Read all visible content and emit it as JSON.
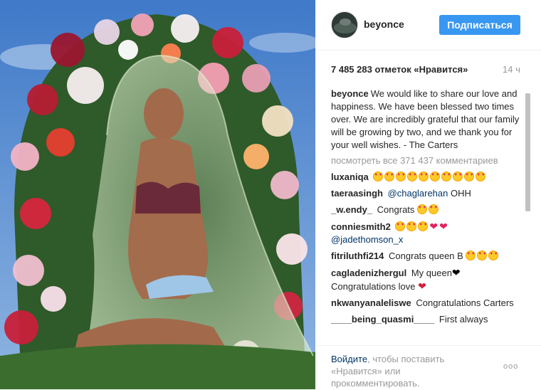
{
  "post": {
    "username": "beyonce",
    "follow_label": "Подписаться",
    "likes_text": "7 485 283 отметок «Нравится»",
    "time_ago": "14 ч",
    "caption_user": "beyonce",
    "caption_text": "We would like to share our love and happiness. We have been blessed two times over. We are incredibly grateful that our family will be growing by two, and we thank you for your well wishes. - The Carters",
    "view_all_label": "посмотреть все 371 437 комментариев"
  },
  "comments": [
    {
      "user": "luxaniqa",
      "text": "",
      "emojis": [
        "heart-eyes",
        "heart-eyes",
        "heart-eyes",
        "heart-eyes",
        "heart-eyes",
        "heart-eyes",
        "heart-eyes",
        "heart-eyes",
        "heart-eyes",
        "heart-eyes"
      ]
    },
    {
      "user": "taeraasingh",
      "mention": "@chaglarehan",
      "text": "OHH"
    },
    {
      "user": "_w.endy_",
      "text": "Congrats",
      "emojis": [
        "heart-eyes",
        "heart-eyes"
      ]
    },
    {
      "user": "conniesmith2",
      "mention": "@jadethomson_x",
      "emojis": [
        "heart-eyes",
        "heart-eyes",
        "heart-eyes",
        "revolving-hearts",
        "two-hearts"
      ]
    },
    {
      "user": "fitriluthfi214",
      "text": "Congrats queen B",
      "emojis": [
        "heart-eyes",
        "heart-eyes",
        "heart-eyes"
      ]
    },
    {
      "user": "cagladenizhergul",
      "text": "My queen",
      "text2": "Congratulations love",
      "emojis": [
        "black-heart",
        "broken-heart"
      ]
    },
    {
      "user": "nkwanyanaleliswe",
      "text": "Congratulations Carters"
    },
    {
      "user": "____being_quasmi____",
      "text": "First always"
    }
  ],
  "footer": {
    "login_link": "Войдите",
    "login_rest": ", чтобы поставить «Нравится» или прокомментировать.",
    "more_label": "ooo"
  },
  "icons": {
    "more": "more-options-icon",
    "emoji": "heart-eyes-emoji-icon",
    "heart": "heart-icon"
  },
  "colors": {
    "follow_button": "#3897f0",
    "link": "#003569",
    "muted": "#999999",
    "text": "#262626"
  }
}
